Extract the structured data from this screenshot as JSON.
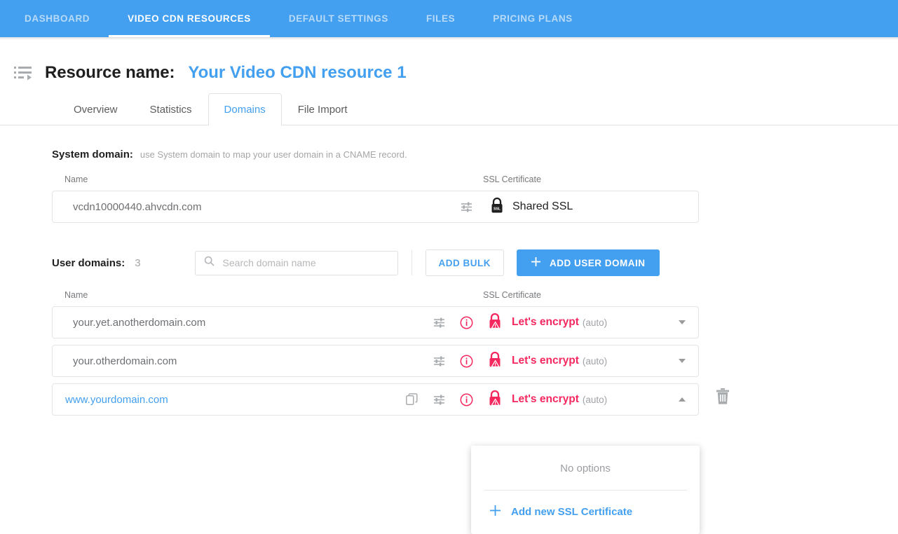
{
  "topnav": {
    "items": [
      {
        "label": "DASHBOARD",
        "active": false
      },
      {
        "label": "VIDEO CDN RESOURCES",
        "active": true
      },
      {
        "label": "DEFAULT SETTINGS",
        "active": false
      },
      {
        "label": "FILES",
        "active": false
      },
      {
        "label": "PRICING PLANS",
        "active": false
      }
    ],
    "accent_bg": "#439fef"
  },
  "header": {
    "menu_icon": "list-collapse-icon",
    "label": "Resource name:",
    "resource_name": "Your Video CDN resource 1",
    "link_color": "#439fef"
  },
  "tabs": [
    {
      "label": "Overview",
      "active": false
    },
    {
      "label": "Statistics",
      "active": false
    },
    {
      "label": "Domains",
      "active": true
    },
    {
      "label": "File Import",
      "active": false
    }
  ],
  "system_domain": {
    "title": "System domain:",
    "hint": "use System domain to map your user domain in a CNAME record.",
    "columns": {
      "name": "Name",
      "ssl": "SSL Certificate"
    },
    "row": {
      "name": "vcdn10000440.ahvcdn.com",
      "settings_icon": "sliders-icon",
      "ssl_icon": "lock-ssl-icon",
      "ssl_label": "Shared SSL"
    }
  },
  "user_domains": {
    "title": "User domains:",
    "count": "3",
    "search": {
      "placeholder": "Search domain name",
      "value": "",
      "icon": "search-icon"
    },
    "add_bulk_label": "ADD BULK",
    "add_user_domain_label": "ADD USER DOMAIN",
    "add_icon": "plus-icon",
    "columns": {
      "name": "Name",
      "ssl": "SSL Certificate"
    },
    "ssl_warning_color": "#f5275f",
    "rows": [
      {
        "name": "your.yet.anotherdomain.com",
        "highlighted": false,
        "icons": [
          "sliders-icon",
          "info-alert-icon"
        ],
        "ssl_icon": "lock-warning-icon",
        "ssl_label": "Let's encrypt",
        "ssl_suffix": "(auto)",
        "caret": "chevron-down-icon",
        "has_trash": false
      },
      {
        "name": "your.otherdomain.com",
        "highlighted": false,
        "icons": [
          "sliders-icon",
          "info-alert-icon"
        ],
        "ssl_icon": "lock-warning-icon",
        "ssl_label": "Let's encrypt",
        "ssl_suffix": "(auto)",
        "caret": "chevron-down-icon",
        "has_trash": false
      },
      {
        "name": "www.yourdomain.com",
        "highlighted": true,
        "icons": [
          "copy-icon",
          "sliders-icon",
          "info-alert-icon"
        ],
        "ssl_icon": "lock-warning-icon",
        "ssl_label": "Let's encrypt",
        "ssl_suffix": "(auto)",
        "caret": "chevron-up-icon",
        "has_trash": true,
        "trash_icon": "trash-icon"
      }
    ]
  },
  "ssl_dropdown": {
    "no_options_label": "No options",
    "add_new_label": "Add new SSL Certificate",
    "add_icon": "plus-icon"
  }
}
